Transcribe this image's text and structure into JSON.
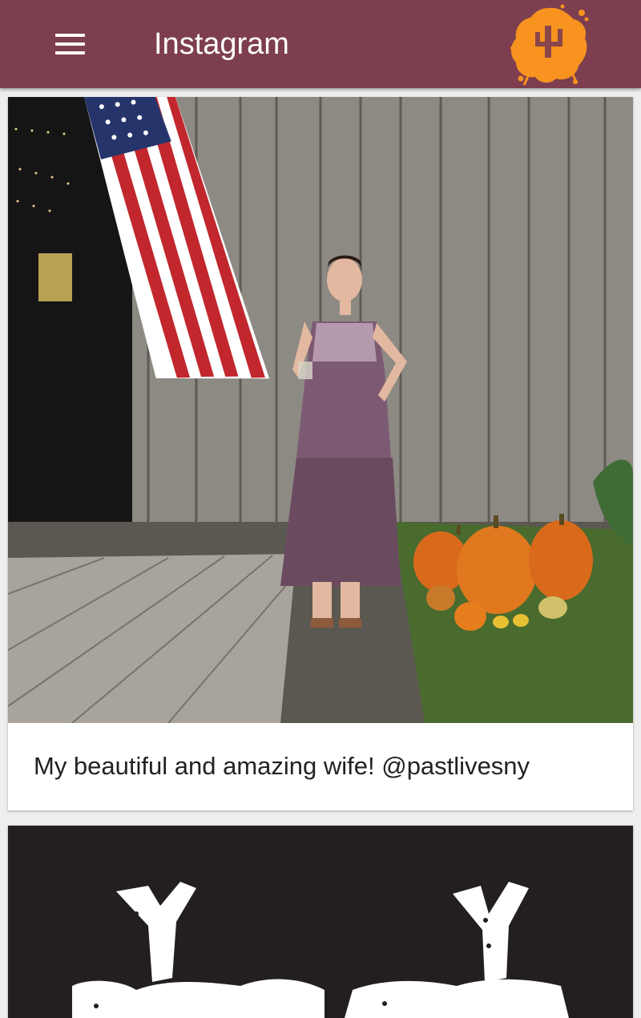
{
  "app": {
    "title": "Instagram",
    "menu_icon": "hamburger-menu-icon",
    "logo_icon": "cactus-splash-logo-icon",
    "brand_color": "#7d3e4f",
    "logo_color": "#f7931e"
  },
  "feed": {
    "posts": [
      {
        "image_icon": "photo-woman-barn-flag-pumpkins",
        "caption": "My beautiful and amazing wife! @pastlivesny"
      },
      {
        "image_icon": "photo-black-white-artwork"
      }
    ]
  }
}
